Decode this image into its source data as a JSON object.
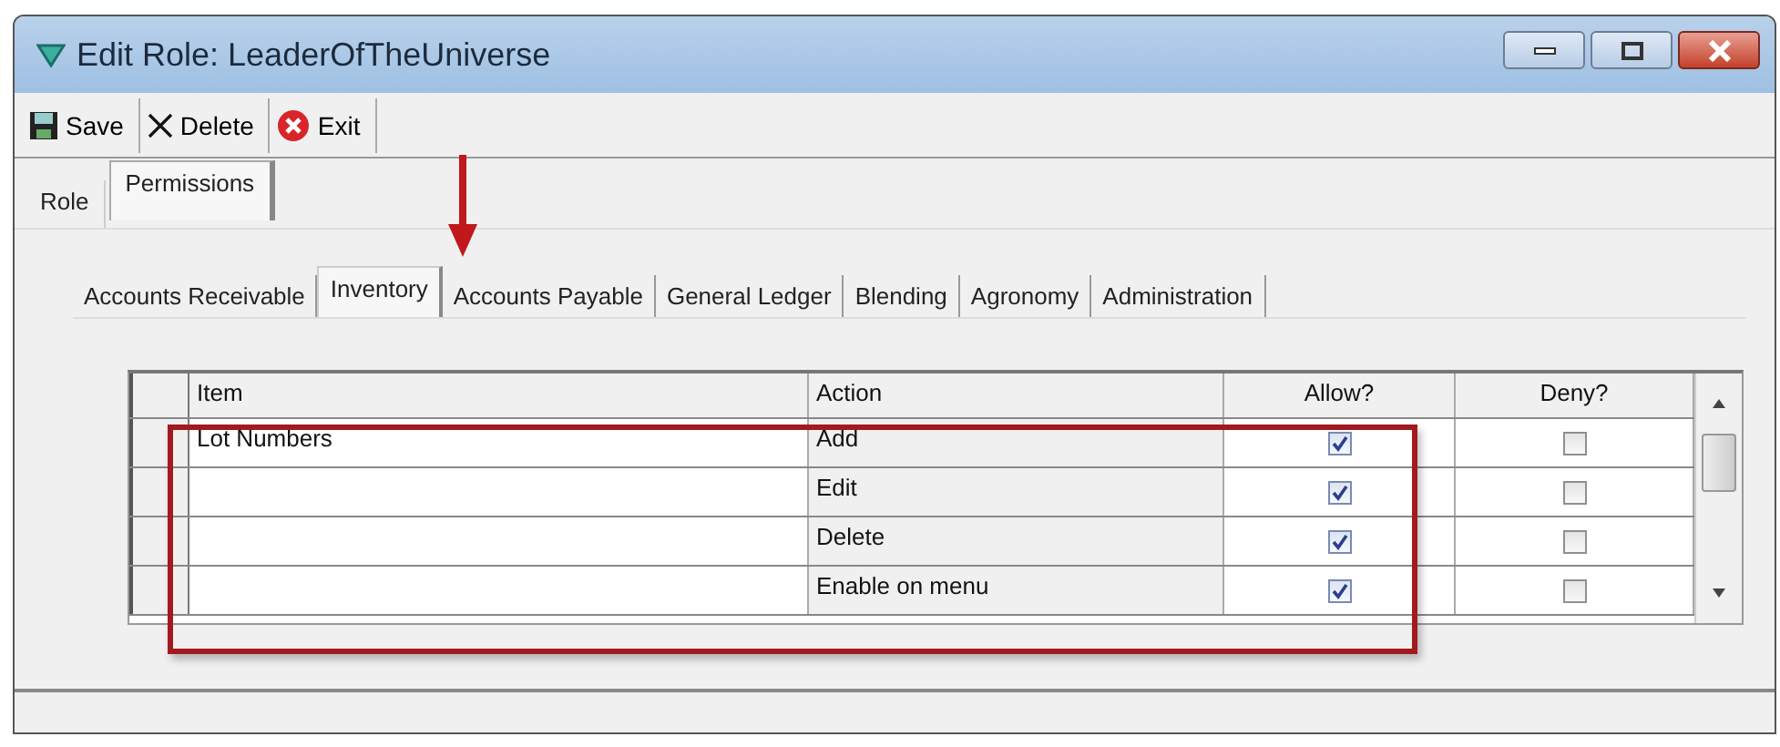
{
  "window": {
    "title": "Edit Role: LeaderOfTheUniverse"
  },
  "toolbar": [
    {
      "label": "Save",
      "kind": "save"
    },
    {
      "label": "Delete",
      "kind": "delete"
    },
    {
      "label": "Exit",
      "kind": "exit"
    }
  ],
  "tabs": [
    {
      "label": "Role",
      "selected": false
    },
    {
      "label": "Permissions",
      "selected": true
    }
  ],
  "module_tabs": [
    {
      "label": "Accounts Receivable",
      "selected": false
    },
    {
      "label": "Inventory",
      "selected": true
    },
    {
      "label": "Accounts Payable",
      "selected": false
    },
    {
      "label": "General Ledger",
      "selected": false
    },
    {
      "label": "Blending",
      "selected": false
    },
    {
      "label": "Agronomy",
      "selected": false
    },
    {
      "label": "Administration",
      "selected": false
    }
  ],
  "table": {
    "columns": [
      "Item",
      "Action",
      "Allow?",
      "Deny?"
    ],
    "rows": [
      {
        "item": "Lot Numbers",
        "action": "Add",
        "allow": true,
        "deny": false
      },
      {
        "item": "",
        "action": "Edit",
        "allow": true,
        "deny": false
      },
      {
        "item": "",
        "action": "Delete",
        "allow": true,
        "deny": false
      },
      {
        "item": "",
        "action": "Enable on menu",
        "allow": true,
        "deny": false
      }
    ]
  }
}
